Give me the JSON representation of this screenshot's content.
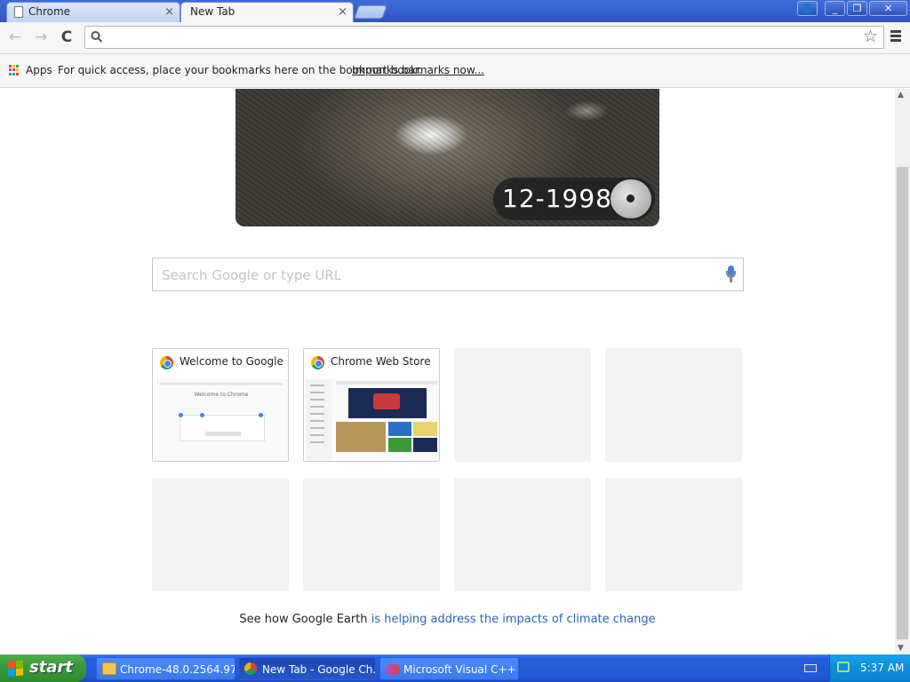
{
  "tabs": [
    {
      "label": "Chrome",
      "active": false
    },
    {
      "label": "New Tab",
      "active": true
    }
  ],
  "tab_close_glyph": "×",
  "toolbar": {
    "back_glyph": "←",
    "forward_glyph": "→",
    "reload_glyph": "C",
    "omnibox_value": "",
    "star_glyph": "☆"
  },
  "window_controls": {
    "minimize": "_",
    "restore": "❐",
    "close": "✕",
    "user": "👤"
  },
  "bookmarks_bar": {
    "apps_label": "Apps",
    "hint": "For quick access, place your bookmarks here on the bookmarks bar.",
    "import_link": "Import bookmarks now..."
  },
  "apps_icon_colors": [
    "#ea4335",
    "#fbbc05",
    "#34a853",
    "#4285f4",
    "#ea4335",
    "#fbbc05",
    "#34a853",
    "#4285f4",
    "#ea4335"
  ],
  "earth": {
    "date": "12-1998",
    "caption_prefix": "See how Google Earth",
    "caption_link": "is helping address the impacts of climate change"
  },
  "search": {
    "placeholder": "Search Google or type URL",
    "value": ""
  },
  "most_visited": [
    {
      "title": "Welcome to Google Chrome",
      "thumb": "welcome"
    },
    {
      "title": "Chrome Web Store",
      "thumb": "store"
    }
  ],
  "welcome_thumb": {
    "heading": "Welcome to Chrome"
  },
  "taskbar": {
    "start_label": "start",
    "start_logo_colors": [
      "#f25022",
      "#7fba00",
      "#00a4ef",
      "#ffb900"
    ],
    "tasks": [
      {
        "label": "Chrome-48.0.2564.97",
        "active": false
      },
      {
        "label": "New Tab - Google Ch...",
        "active": true
      },
      {
        "label": "Microsoft Visual C++",
        "active": false
      }
    ],
    "clock": "5:37 AM"
  },
  "colors": {
    "link": "#2a64b4",
    "taskbar": "#245edb",
    "start": "#3a9a3a"
  }
}
